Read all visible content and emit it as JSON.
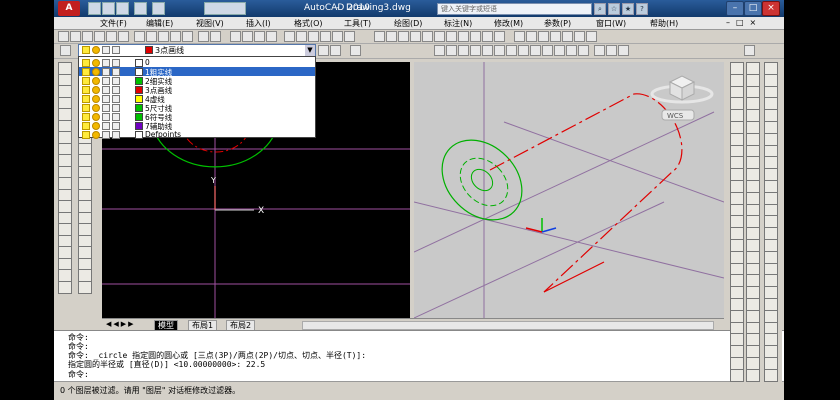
{
  "window": {
    "app_title": "AutoCAD 2010",
    "file_title": "Drawing3.dwg",
    "separator": "-",
    "help_placeholder": "键入关键字或短语"
  },
  "menus": [
    "文件(F)",
    "编辑(E)",
    "视图(V)",
    "插入(I)",
    "格式(O)",
    "工具(T)",
    "绘图(D)",
    "标注(N)",
    "修改(M)",
    "参数(P)",
    "窗口(W)",
    "帮助(H)"
  ],
  "layer_combo": {
    "current": "3点画线"
  },
  "layers": [
    {
      "name": "0",
      "color": "#ffffff",
      "selected": false
    },
    {
      "name": "1粗实线",
      "color": "#ffffff",
      "selected": true
    },
    {
      "name": "2细实线",
      "color": "#00c000",
      "selected": false
    },
    {
      "name": "3点画线",
      "color": "#e00000",
      "selected": false
    },
    {
      "name": "4虚线",
      "color": "#ffff00",
      "selected": false
    },
    {
      "name": "5尺寸线",
      "color": "#00c000",
      "selected": false
    },
    {
      "name": "6符号线",
      "color": "#00c000",
      "selected": false
    },
    {
      "name": "7辅助线",
      "color": "#7000c0",
      "selected": false
    },
    {
      "name": "Defpoints",
      "color": "#ffffff",
      "selected": false
    }
  ],
  "viewcube_label": "WCS",
  "axis_label_y": "Y",
  "axis_label_x": "X",
  "layout_tabs": [
    "模型",
    "布局1",
    "布局2"
  ],
  "command_lines": [
    "命令:",
    "命令:",
    "命令: _circle 指定圆的圆心或 [三点(3P)/两点(2P)/切点、切点、半径(T)]:",
    "指定圆的半径或 [直径(D)] <10.00000000>: 22.5",
    "命令:"
  ],
  "status_text": "0 个图层被过滤。请用 \"图层\" 对话框修改过滤器。",
  "colors": {
    "title_bg": "#123a6c",
    "viewport_bg": "#000000",
    "iso_bg": "#c9c9c9",
    "selection": "#2b67c6"
  }
}
